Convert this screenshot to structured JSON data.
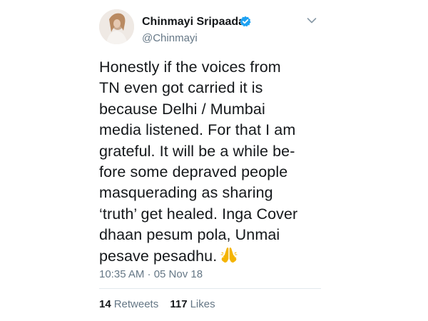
{
  "tweet": {
    "author": {
      "display_name": "Chinmayi Sripaada",
      "handle": "@Chinmayi",
      "verified": true,
      "avatar_icon": "profile-photo"
    },
    "text_lines": [
      "Honestly if the voices from",
      "TN even got carried it is",
      "because Delhi / Mumbai",
      "media listened. For that I am",
      "grateful. It will be a while be-",
      "fore some depraved people",
      "masquerading as sharing",
      "‘truth’ get healed. Inga Cover",
      "dhaan pesum pola, Unmai",
      "pesave pesadhu."
    ],
    "emoji": "folded-hands",
    "timestamp": "10:35 AM · 05 Nov 18",
    "stats": {
      "retweets_count": "14",
      "retweets_label": "Retweets",
      "likes_count": "117",
      "likes_label": "Likes"
    }
  },
  "colors": {
    "text_primary": "#14171a",
    "text_secondary": "#657786",
    "verified_blue": "#1da1f2",
    "divider": "#e1e8ed",
    "emoji_yellow": "#f4b400"
  }
}
